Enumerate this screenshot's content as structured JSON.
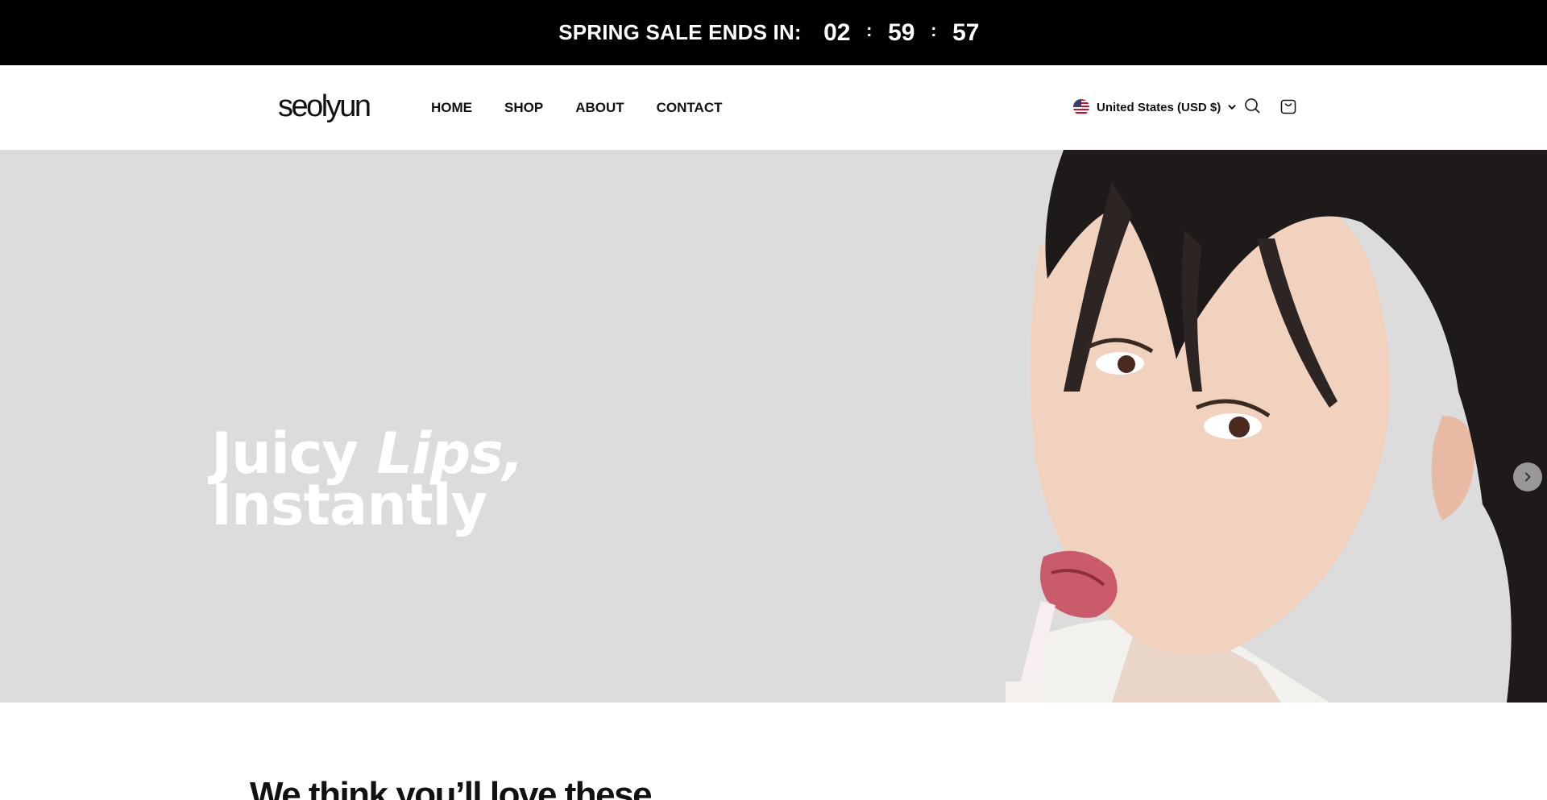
{
  "announcement": {
    "label": "SPRING SALE ENDS IN:",
    "hours": "02",
    "minutes": "59",
    "seconds": "57",
    "separator": ":"
  },
  "header": {
    "logo": "seolyun",
    "nav": [
      {
        "label": "HOME"
      },
      {
        "label": "SHOP"
      },
      {
        "label": "ABOUT"
      },
      {
        "label": "CONTACT"
      }
    ],
    "locale": {
      "label": "United States (USD $)",
      "flag_icon": "us-flag-icon"
    },
    "icons": [
      "search-icon",
      "cart-icon",
      "chevron-down-icon"
    ]
  },
  "hero": {
    "title_word_1": "Juicy ",
    "title_word_2": "Lips,",
    "title_line_2": "Instantly",
    "background_color": "#dcdcdc",
    "next_icon": "chevron-right-icon"
  },
  "section": {
    "title": "We think you’ll love these"
  }
}
